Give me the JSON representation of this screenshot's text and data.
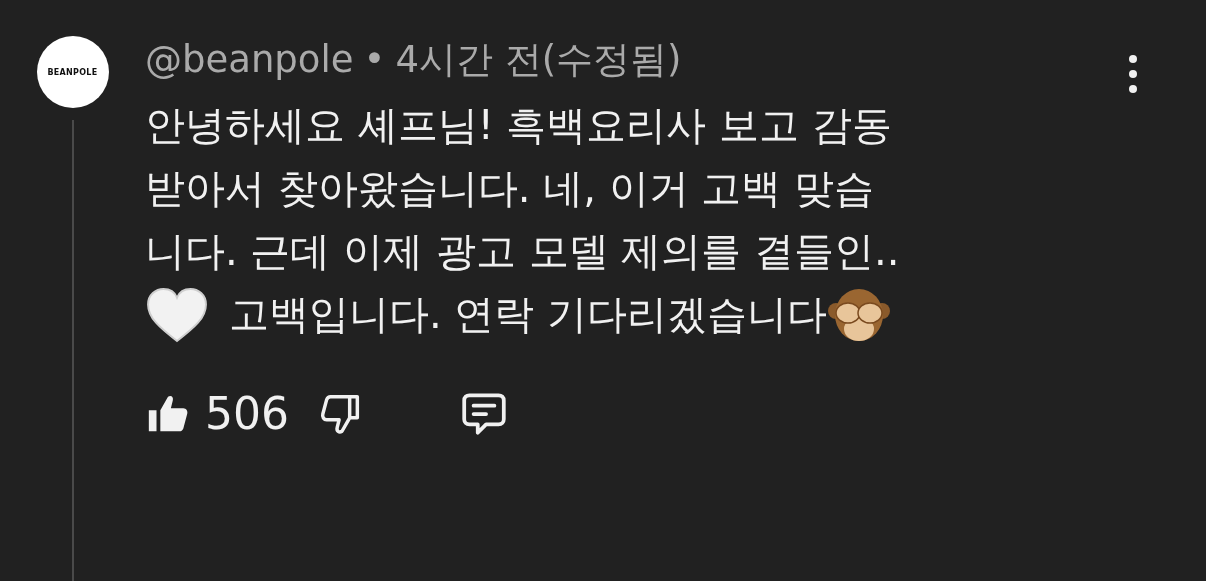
{
  "comment": {
    "avatar_label": "BEANPOLE",
    "author": "@beanpole",
    "separator": "•",
    "time": "4시간 전",
    "edited": "(수정됨)",
    "text_lines": [
      "안녕하세요 셰프님! 흑백요리사 보고 감동",
      "받아서 찾아왔습니다. 네, 이거 고백 맞습",
      "니다. 근데 이제 광고 모델 제의를 곁들인.."
    ],
    "last_line": "고백입니다. 연락 기다리겠습니다",
    "likes": "506"
  }
}
